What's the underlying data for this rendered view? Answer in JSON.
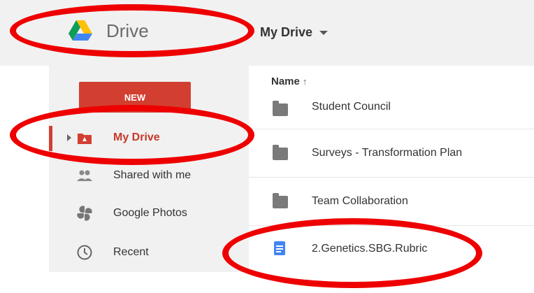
{
  "header": {
    "app_name": "Drive",
    "location_title": "My Drive"
  },
  "sidebar": {
    "new_label": "NEW",
    "items": [
      {
        "label": "My Drive",
        "icon": "my-drive-icon",
        "active": true
      },
      {
        "label": "Shared with me",
        "icon": "shared-people-icon"
      },
      {
        "label": "Google Photos",
        "icon": "google-photos-icon"
      },
      {
        "label": "Recent",
        "icon": "clock-icon"
      }
    ]
  },
  "list": {
    "column_name": "Name",
    "sort_arrow": "↑",
    "rows": [
      {
        "name": "Student Council",
        "type": "folder"
      },
      {
        "name": "Surveys - Transformation Plan",
        "type": "folder"
      },
      {
        "name": "Team Collaboration",
        "type": "folder"
      },
      {
        "name": "2.Genetics.SBG.Rubric",
        "type": "document"
      }
    ]
  },
  "colors": {
    "accent_red": "#d23f31",
    "annotation_red": "#ee0000",
    "doc_blue": "#4285f4"
  }
}
